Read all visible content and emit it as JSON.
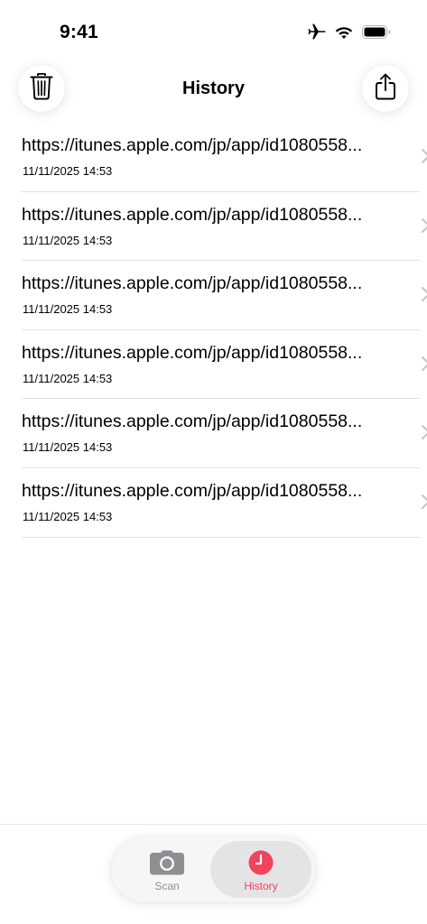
{
  "status_bar": {
    "time": "9:41",
    "icons": [
      "airplane-icon",
      "wifi-icon",
      "battery-icon"
    ]
  },
  "nav": {
    "title": "History",
    "left_icon": "trash-icon",
    "right_icon": "share-icon"
  },
  "history": {
    "items": [
      {
        "url": "https://itunes.apple.com/jp/app/id1080558...",
        "date": "11/11/2025 14:53"
      },
      {
        "url": "https://itunes.apple.com/jp/app/id1080558...",
        "date": "11/11/2025 14:53"
      },
      {
        "url": "https://itunes.apple.com/jp/app/id1080558...",
        "date": "11/11/2025 14:53"
      },
      {
        "url": "https://itunes.apple.com/jp/app/id1080558...",
        "date": "11/11/2025 14:53"
      },
      {
        "url": "https://itunes.apple.com/jp/app/id1080558...",
        "date": "11/11/2025 14:53"
      },
      {
        "url": "https://itunes.apple.com/jp/app/id1080558...",
        "date": "11/11/2025 14:53"
      }
    ]
  },
  "tab_bar": {
    "tabs": [
      {
        "label": "Scan",
        "icon": "camera-icon",
        "selected": false
      },
      {
        "label": "History",
        "icon": "clock-icon",
        "selected": true
      }
    ]
  },
  "colors": {
    "accent": "#f0445c",
    "inactive": "#8e8e93",
    "separator": "#e3e3e6",
    "chevron": "#c4c4c7"
  }
}
